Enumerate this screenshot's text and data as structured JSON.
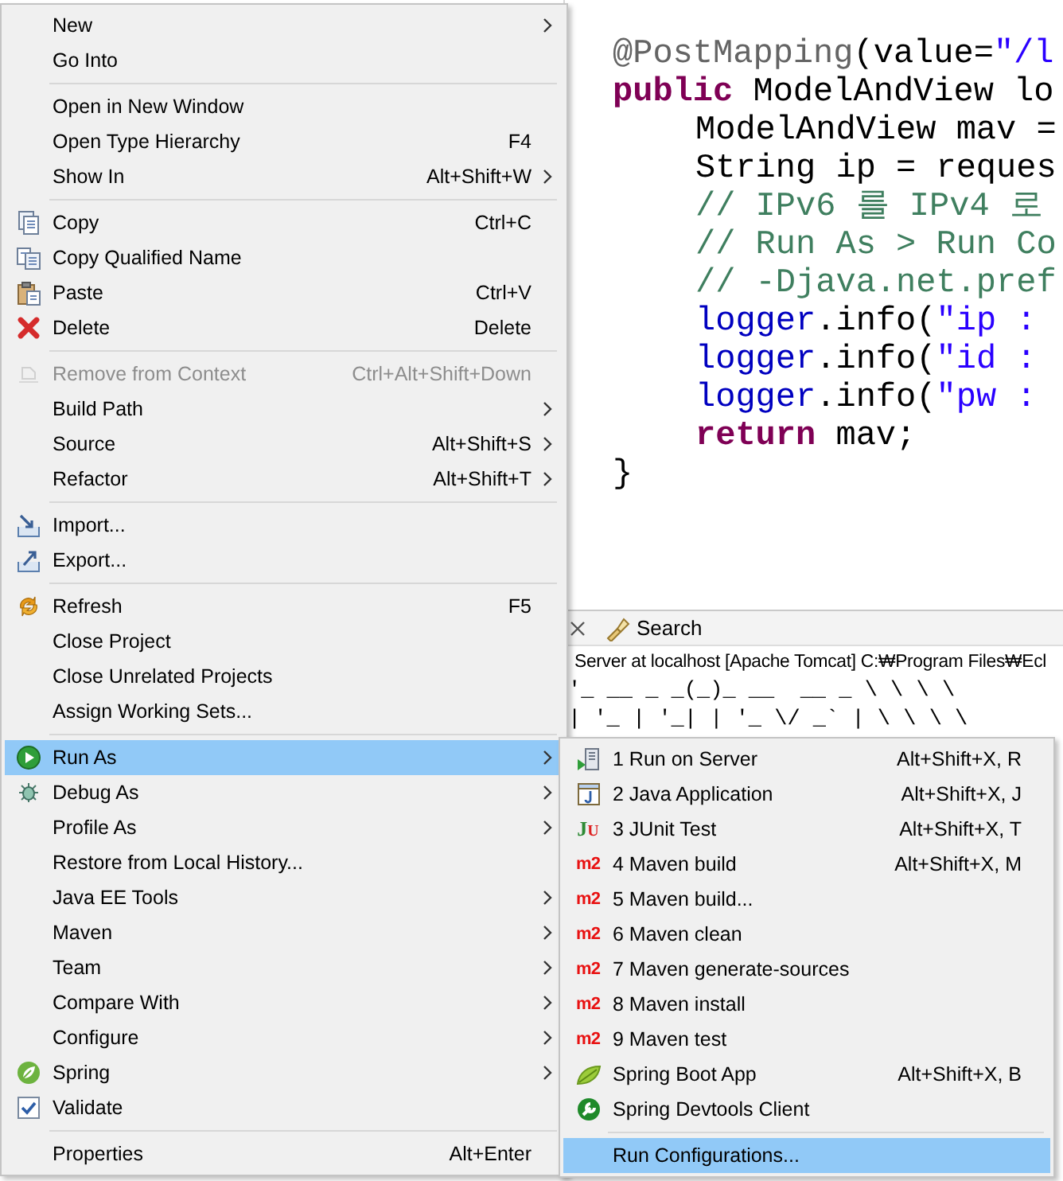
{
  "editor": {
    "lines": [
      {
        "tokens": [
          {
            "kind": "annotation",
            "text": "@PostMapping"
          },
          {
            "kind": "plain",
            "text": "(value="
          },
          {
            "kind": "string",
            "text": "\"/l"
          }
        ]
      },
      {
        "tokens": [
          {
            "kind": "keyword",
            "text": "public"
          },
          {
            "kind": "plain",
            "text": " ModelAndView lo"
          }
        ],
        "children": [
          {
            "tokens": [
              {
                "kind": "plain",
                "text": "ModelAndView mav ="
              }
            ]
          },
          {
            "tokens": [
              {
                "kind": "plain",
                "text": "String ip = reques"
              }
            ]
          },
          {
            "tokens": [
              {
                "kind": "comment",
                "text": "// IPv6 를 IPv4 로"
              }
            ]
          },
          {
            "tokens": [
              {
                "kind": "comment",
                "text": "// Run As > Run Co"
              }
            ]
          },
          {
            "tokens": [
              {
                "kind": "comment",
                "text": "// -Djava.net.pref"
              }
            ]
          },
          {
            "tokens": [
              {
                "kind": "field",
                "text": "logger"
              },
              {
                "kind": "plain",
                "text": ".info("
              },
              {
                "kind": "string",
                "text": "\"ip :"
              }
            ]
          },
          {
            "tokens": [
              {
                "kind": "field",
                "text": "logger"
              },
              {
                "kind": "plain",
                "text": ".info("
              },
              {
                "kind": "string",
                "text": "\"id :"
              }
            ]
          },
          {
            "tokens": [
              {
                "kind": "field",
                "text": "logger"
              },
              {
                "kind": "plain",
                "text": ".info("
              },
              {
                "kind": "string",
                "text": "\"pw :"
              }
            ]
          },
          {
            "tokens": [
              {
                "kind": "keyword",
                "text": "return"
              },
              {
                "kind": "plain",
                "text": " mav;"
              }
            ]
          }
        ]
      },
      {
        "tokens": [
          {
            "kind": "plain",
            "text": "}"
          }
        ]
      }
    ]
  },
  "console": {
    "tab_label": "Search",
    "header": "Server at localhost [Apache Tomcat] C:₩Program Files₩Ecl",
    "output": [
      "'_ __ _ _(_)_ __  __ _ \\ \\ \\ \\",
      "| '_ | '_| | '_ \\/ _` | \\ \\ \\ \\"
    ]
  },
  "context_menu": {
    "items": [
      {
        "kind": "item",
        "label": "New",
        "submenu": true,
        "disabled": false,
        "selected": false
      },
      {
        "kind": "item",
        "label": "Go Into",
        "submenu": false,
        "disabled": false,
        "selected": false
      },
      {
        "kind": "separator"
      },
      {
        "kind": "item",
        "label": "Open in New Window",
        "submenu": false,
        "disabled": false,
        "selected": false
      },
      {
        "kind": "item",
        "label": "Open Type Hierarchy",
        "shortcut": "F4",
        "submenu": false,
        "disabled": false,
        "selected": false
      },
      {
        "kind": "item",
        "label": "Show In",
        "shortcut": "Alt+Shift+W",
        "submenu": true,
        "disabled": false,
        "selected": false
      },
      {
        "kind": "separator"
      },
      {
        "kind": "item",
        "label": "Copy",
        "shortcut": "Ctrl+C",
        "submenu": false,
        "disabled": false,
        "selected": false
      },
      {
        "kind": "item",
        "label": "Copy Qualified Name",
        "submenu": false,
        "disabled": false,
        "selected": false
      },
      {
        "kind": "item",
        "label": "Paste",
        "shortcut": "Ctrl+V",
        "submenu": false,
        "disabled": false,
        "selected": false
      },
      {
        "kind": "item",
        "label": "Delete",
        "shortcut": "Delete",
        "submenu": false,
        "disabled": false,
        "selected": false
      },
      {
        "kind": "separator"
      },
      {
        "kind": "item",
        "label": "Remove from Context",
        "shortcut": "Ctrl+Alt+Shift+Down",
        "submenu": false,
        "disabled": true,
        "selected": false
      },
      {
        "kind": "item",
        "label": "Build Path",
        "submenu": true,
        "disabled": false,
        "selected": false
      },
      {
        "kind": "item",
        "label": "Source",
        "shortcut": "Alt+Shift+S",
        "submenu": true,
        "disabled": false,
        "selected": false
      },
      {
        "kind": "item",
        "label": "Refactor",
        "shortcut": "Alt+Shift+T",
        "submenu": true,
        "disabled": false,
        "selected": false
      },
      {
        "kind": "separator"
      },
      {
        "kind": "item",
        "label": "Import...",
        "submenu": false,
        "disabled": false,
        "selected": false
      },
      {
        "kind": "item",
        "label": "Export...",
        "submenu": false,
        "disabled": false,
        "selected": false
      },
      {
        "kind": "separator"
      },
      {
        "kind": "item",
        "label": "Refresh",
        "shortcut": "F5",
        "submenu": false,
        "disabled": false,
        "selected": false
      },
      {
        "kind": "item",
        "label": "Close Project",
        "submenu": false,
        "disabled": false,
        "selected": false
      },
      {
        "kind": "item",
        "label": "Close Unrelated Projects",
        "submenu": false,
        "disabled": false,
        "selected": false
      },
      {
        "kind": "item",
        "label": "Assign Working Sets...",
        "submenu": false,
        "disabled": false,
        "selected": false
      },
      {
        "kind": "separator"
      },
      {
        "kind": "item",
        "label": "Run As",
        "submenu": true,
        "disabled": false,
        "selected": true
      },
      {
        "kind": "item",
        "label": "Debug As",
        "submenu": true,
        "disabled": false,
        "selected": false
      },
      {
        "kind": "item",
        "label": "Profile As",
        "submenu": true,
        "disabled": false,
        "selected": false
      },
      {
        "kind": "item",
        "label": "Restore from Local History...",
        "submenu": false,
        "disabled": false,
        "selected": false
      },
      {
        "kind": "item",
        "label": "Java EE Tools",
        "submenu": true,
        "disabled": false,
        "selected": false
      },
      {
        "kind": "item",
        "label": "Maven",
        "submenu": true,
        "disabled": false,
        "selected": false
      },
      {
        "kind": "item",
        "label": "Team",
        "submenu": true,
        "disabled": false,
        "selected": false
      },
      {
        "kind": "item",
        "label": "Compare With",
        "submenu": true,
        "disabled": false,
        "selected": false
      },
      {
        "kind": "item",
        "label": "Configure",
        "submenu": true,
        "disabled": false,
        "selected": false
      },
      {
        "kind": "item",
        "label": "Spring",
        "submenu": true,
        "disabled": false,
        "selected": false
      },
      {
        "kind": "item",
        "label": "Validate",
        "submenu": false,
        "disabled": false,
        "selected": false
      },
      {
        "kind": "separator"
      },
      {
        "kind": "item",
        "label": "Properties",
        "shortcut": "Alt+Enter",
        "submenu": false,
        "disabled": false,
        "selected": false
      }
    ]
  },
  "run_as_submenu": {
    "items": [
      {
        "kind": "item",
        "label": "1 Run on Server",
        "shortcut": "Alt+Shift+X, R",
        "selected": false
      },
      {
        "kind": "item",
        "label": "2 Java Application",
        "shortcut": "Alt+Shift+X, J",
        "selected": false
      },
      {
        "kind": "item",
        "label": "3 JUnit Test",
        "shortcut": "Alt+Shift+X, T",
        "icon_text": "JU",
        "selected": false
      },
      {
        "kind": "item",
        "label": "4 Maven build",
        "shortcut": "Alt+Shift+X, M",
        "icon_text": "m2",
        "selected": false
      },
      {
        "kind": "item",
        "label": "5 Maven build...",
        "icon_text": "m2",
        "selected": false
      },
      {
        "kind": "item",
        "label": "6 Maven clean",
        "icon_text": "m2",
        "selected": false
      },
      {
        "kind": "item",
        "label": "7 Maven generate-sources",
        "icon_text": "m2",
        "selected": false
      },
      {
        "kind": "item",
        "label": "8 Maven install",
        "icon_text": "m2",
        "selected": false
      },
      {
        "kind": "item",
        "label": "9 Maven test",
        "icon_text": "m2",
        "selected": false
      },
      {
        "kind": "item",
        "label": "Spring Boot App",
        "shortcut": "Alt+Shift+X, B",
        "selected": false
      },
      {
        "kind": "item",
        "label": "Spring Devtools Client",
        "selected": false
      },
      {
        "kind": "separator"
      },
      {
        "kind": "item",
        "label": "Run Configurations...",
        "selected": true
      }
    ]
  }
}
